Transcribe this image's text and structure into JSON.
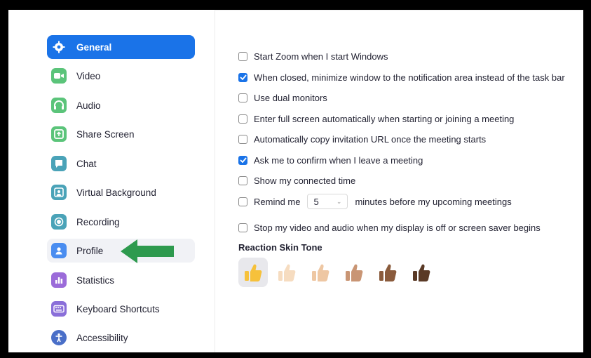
{
  "sidebar": {
    "items": [
      {
        "label": "General",
        "icon": "gear-icon"
      },
      {
        "label": "Video",
        "icon": "video-icon"
      },
      {
        "label": "Audio",
        "icon": "headphones-icon"
      },
      {
        "label": "Share Screen",
        "icon": "share-screen-icon"
      },
      {
        "label": "Chat",
        "icon": "chat-icon"
      },
      {
        "label": "Virtual Background",
        "icon": "virtual-background-icon"
      },
      {
        "label": "Recording",
        "icon": "recording-icon"
      },
      {
        "label": "Profile",
        "icon": "profile-icon"
      },
      {
        "label": "Statistics",
        "icon": "statistics-icon"
      },
      {
        "label": "Keyboard Shortcuts",
        "icon": "keyboard-icon"
      },
      {
        "label": "Accessibility",
        "icon": "accessibility-icon"
      }
    ],
    "active_index": 0,
    "highlighted_index": 7
  },
  "settings": {
    "options": [
      {
        "label": "Start Zoom when I start Windows",
        "checked": false
      },
      {
        "label": "When closed, minimize window to the notification area instead of the task bar",
        "checked": true
      },
      {
        "label": "Use dual monitors",
        "checked": false
      },
      {
        "label": "Enter full screen automatically when starting or joining a meeting",
        "checked": false
      },
      {
        "label": "Automatically copy invitation URL once the meeting starts",
        "checked": false
      },
      {
        "label": "Ask me to confirm when I leave a meeting",
        "checked": true
      },
      {
        "label": "Show my connected time",
        "checked": false
      }
    ],
    "remind": {
      "prefix": "Remind me",
      "value": "5",
      "suffix": "minutes before my upcoming meetings",
      "checked": false
    },
    "stop_video": {
      "label": "Stop my video and audio when my display is off or screen saver begins",
      "checked": false
    }
  },
  "reaction": {
    "title": "Reaction Skin Tone",
    "tones": [
      "#f6c13b",
      "#f6dcc0",
      "#eec7a3",
      "#c99574",
      "#8a5b3c",
      "#5a3a26"
    ],
    "selected_index": 0
  },
  "colors": {
    "accent": "#1a73e8",
    "annotation_arrow": "#2e9a4e",
    "icon_colors": [
      "#ffffff",
      "#5bc47a",
      "#5bc47a",
      "#5bc47a",
      "#4aa3b8",
      "#4aa3b8",
      "#4aa3b8",
      "#4a8df0",
      "#9b6bd9",
      "#8a6fd9",
      "#4a6fc8"
    ]
  }
}
